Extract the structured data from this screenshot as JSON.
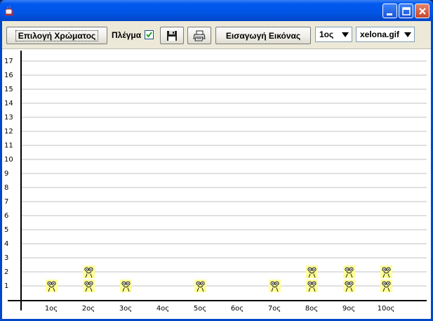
{
  "window": {
    "icon": "java-cup-icon",
    "controls": [
      "minimize-icon",
      "maximize-icon",
      "close-icon"
    ]
  },
  "toolbar": {
    "color_button_label": "Επιλογή Χρώματος",
    "grid_label": "Πλέγμα",
    "grid_checked": true,
    "save_icon": "floppy-disk-icon",
    "print_icon": "printer-icon",
    "insert_image_label": "Εισαγωγή Εικόνας",
    "player_select": {
      "selected": "1ος"
    },
    "image_select": {
      "selected": "xelona.gif"
    }
  },
  "chart_data": {
    "type": "bar",
    "marker_icon": "smiley-face-icon",
    "marker_color": "#ffff99",
    "grid": true,
    "ylim": [
      0,
      17
    ],
    "y_ticks": [
      1,
      2,
      3,
      4,
      5,
      6,
      7,
      8,
      9,
      10,
      11,
      12,
      13,
      14,
      15,
      16,
      17
    ],
    "categories": [
      "1ος",
      "2ος",
      "3ος",
      "4ος",
      "5ος",
      "6ος",
      "7ος",
      "8ος",
      "9ος",
      "10ος"
    ],
    "values": [
      1,
      2,
      1,
      0,
      1,
      0,
      1,
      2,
      2,
      2
    ]
  }
}
